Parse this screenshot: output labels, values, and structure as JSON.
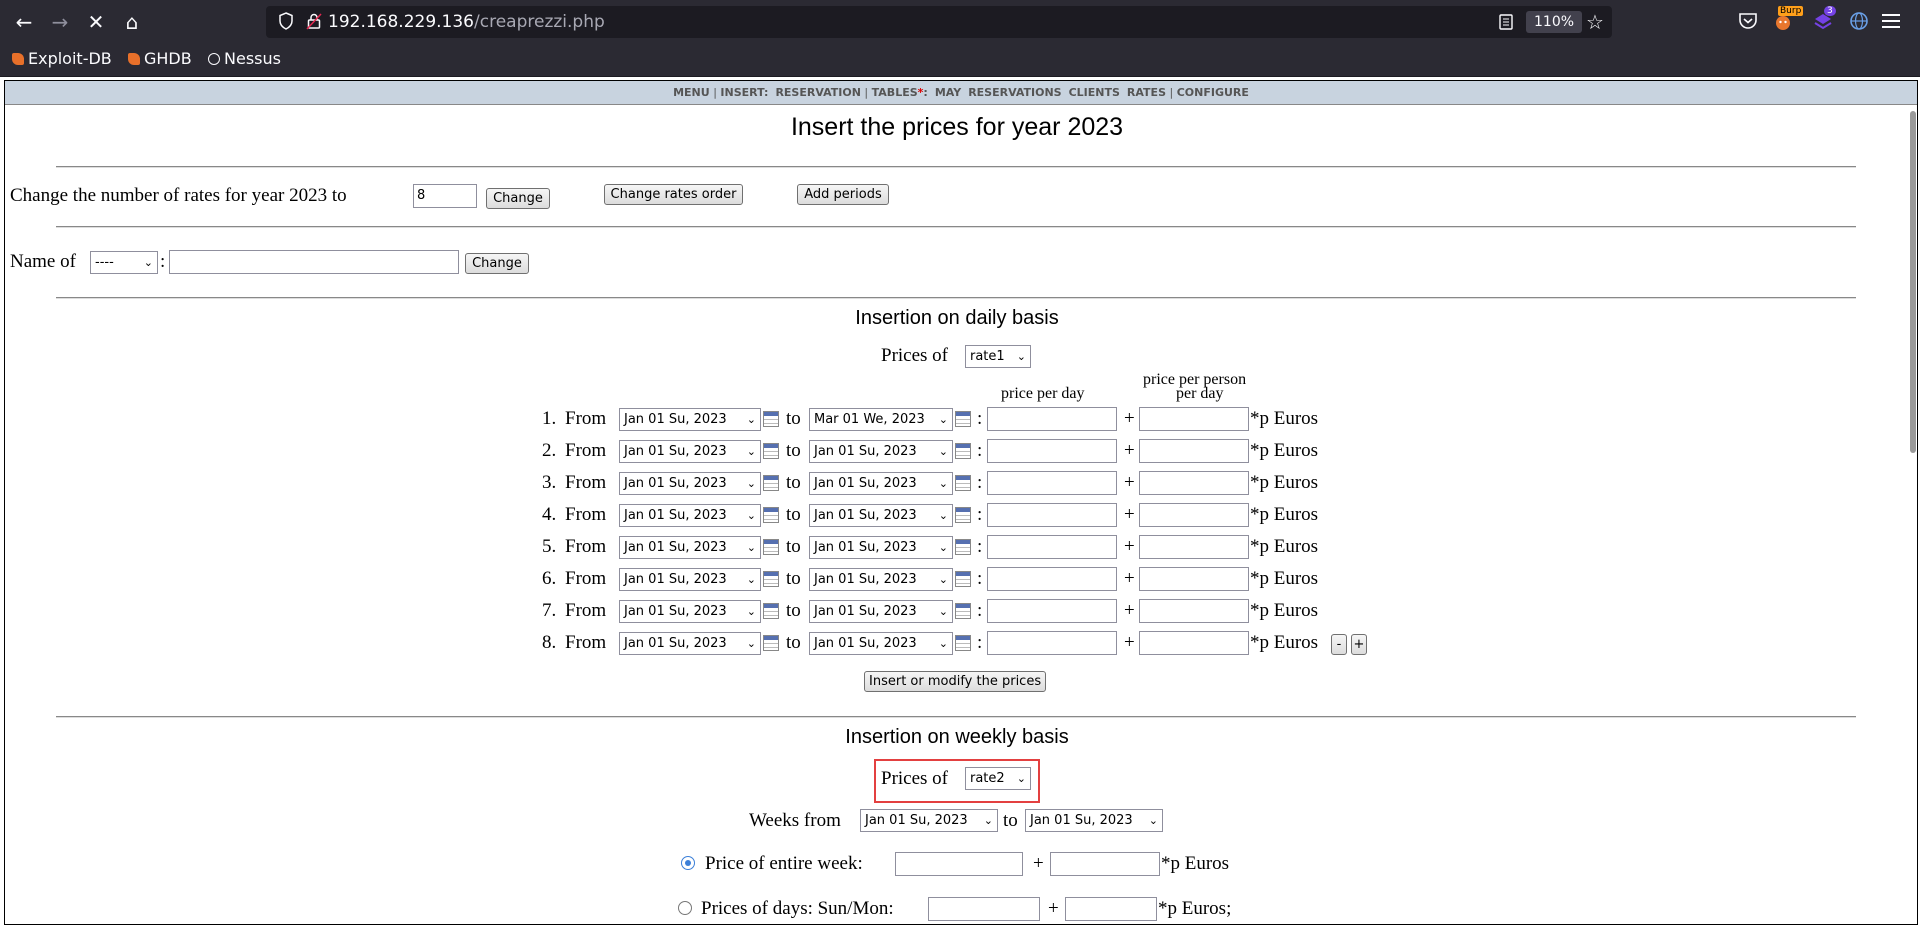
{
  "browser": {
    "url_host": "192.168.229.136",
    "url_path": "/creaprezzi.php",
    "zoom": "110%",
    "burp_badge": "Burp",
    "ext_badge": "3",
    "bookmarks": [
      "Exploit-DB",
      "GHDB",
      "Nessus"
    ]
  },
  "menubar": {
    "menu": "MENU",
    "insert": "INSERT:",
    "reservation": "RESERVATION",
    "tables": "TABLES",
    "tables_star": "*",
    "colon": ":",
    "may": "MAY",
    "reservations": "RESERVATIONS",
    "clients": "CLIENTS",
    "rates": "RATES",
    "configure": "CONFIGURE"
  },
  "page": {
    "title": "Insert the prices for year 2023",
    "change_rates_label": "Change the number of rates for year 2023 to",
    "rates_count_value": "8",
    "change_button": "Change",
    "change_order_button": "Change rates order",
    "add_periods_button": "Add periods",
    "name_of_label": "Name of",
    "name_select_value": "----",
    "colon": ":",
    "name_change_button": "Change"
  },
  "daily": {
    "heading": "Insertion on daily basis",
    "prices_of_label": "Prices of",
    "rate_value": "rate1",
    "col_price_per_day": "price per day",
    "col_price_per_person_1": "price per person",
    "col_price_per_person_2": "per day",
    "from": "From",
    "to": "to",
    "colon": ":",
    "plus": "+",
    "euros": "*p Euros",
    "rows": [
      {
        "num": "1.",
        "from": "Jan 01 Su, 2023",
        "to": "Mar 01 We, 2023"
      },
      {
        "num": "2.",
        "from": "Jan 01 Su, 2023",
        "to": "Jan 01 Su, 2023"
      },
      {
        "num": "3.",
        "from": "Jan 01 Su, 2023",
        "to": "Jan 01 Su, 2023"
      },
      {
        "num": "4.",
        "from": "Jan 01 Su, 2023",
        "to": "Jan 01 Su, 2023"
      },
      {
        "num": "5.",
        "from": "Jan 01 Su, 2023",
        "to": "Jan 01 Su, 2023"
      },
      {
        "num": "6.",
        "from": "Jan 01 Su, 2023",
        "to": "Jan 01 Su, 2023"
      },
      {
        "num": "7.",
        "from": "Jan 01 Su, 2023",
        "to": "Jan 01 Su, 2023"
      },
      {
        "num": "8.",
        "from": "Jan 01 Su, 2023",
        "to": "Jan 01 Su, 2023"
      }
    ],
    "minus_button": "-",
    "plus_button": "+",
    "submit_button": "Insert or modify the prices"
  },
  "weekly": {
    "heading": "Insertion on weekly basis",
    "prices_of_label": "Prices of",
    "rate_value": "rate2",
    "weeks_from_label": "Weeks from",
    "weeks_from_value": "Jan 01 Su, 2023",
    "to": "to",
    "weeks_to_value": "Jan 01 Su, 2023",
    "entire_week_label": "Price of entire week:",
    "plus": "+",
    "euros": "*p Euros",
    "days_label": "Prices of days: Sun/Mon:",
    "euros_semi": "*p Euros;"
  }
}
